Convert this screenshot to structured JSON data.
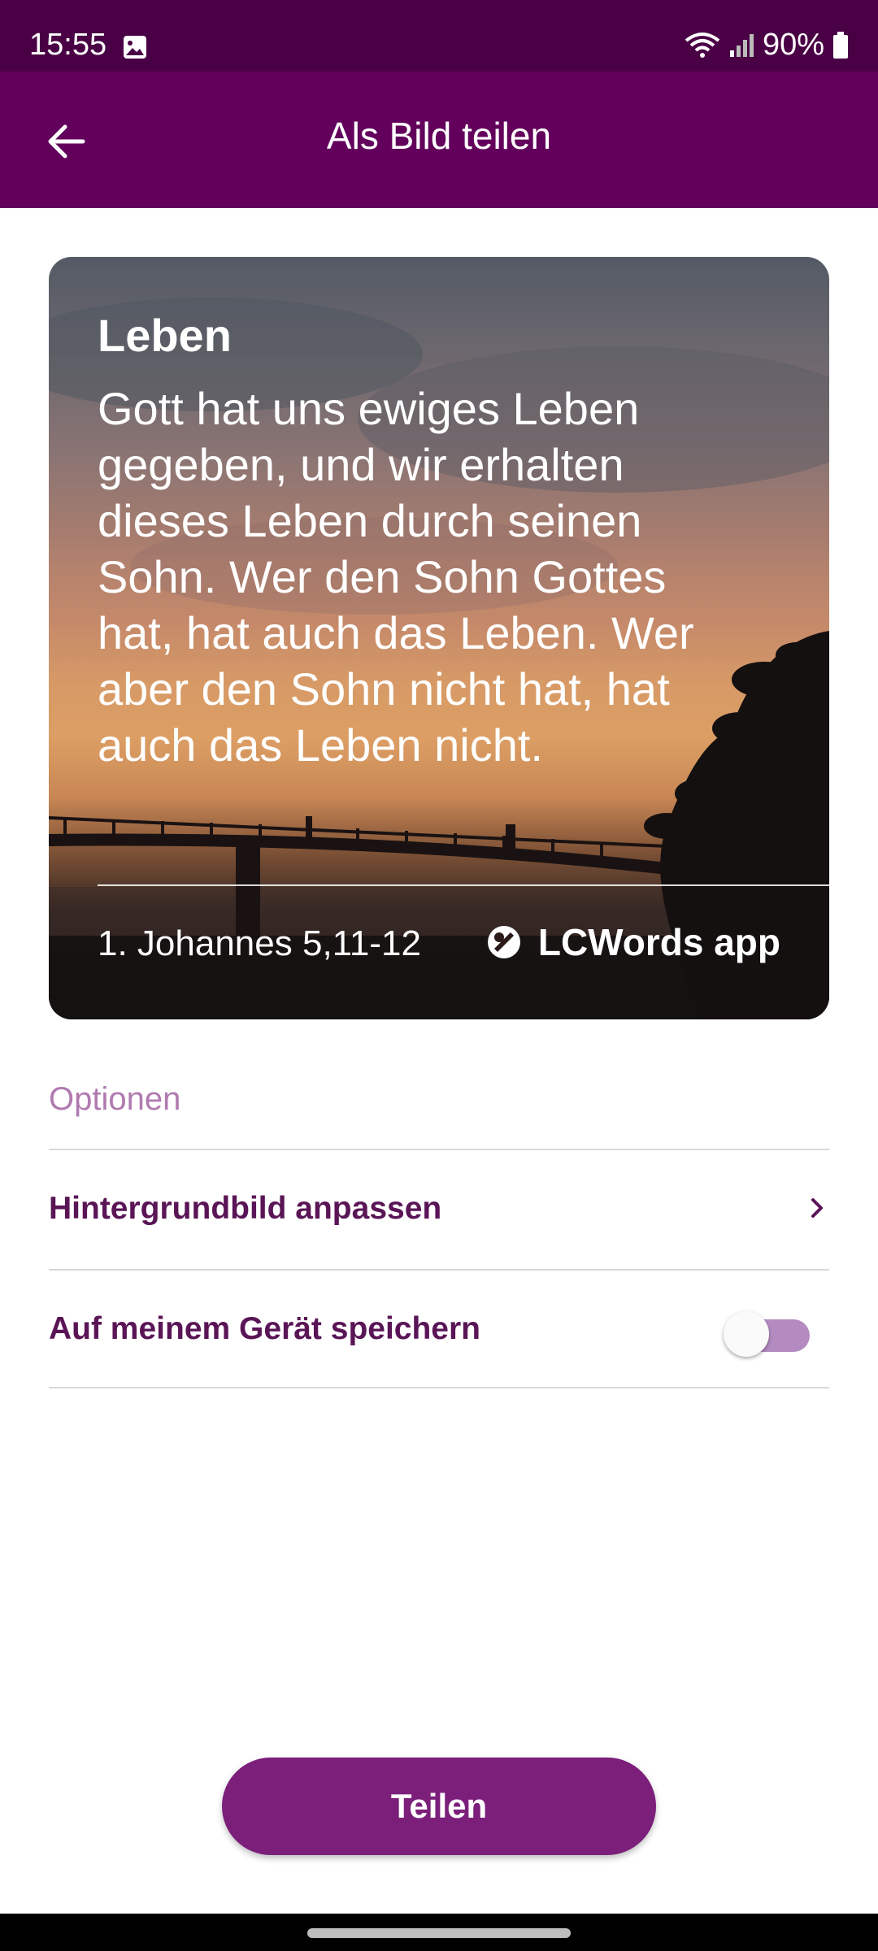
{
  "status_bar": {
    "time": "15:55",
    "battery": "90%",
    "icons": [
      "photo-icon",
      "wifi-icon",
      "signal-icon",
      "battery-icon"
    ]
  },
  "app_bar": {
    "title": "Als Bild teilen",
    "back_icon": "arrow-left-icon"
  },
  "card": {
    "title": "Leben",
    "verse": "Gott hat uns ewiges Leben gegeben, und wir erhalten dieses Leben durch seinen Sohn. Wer den Sohn Gottes hat, hat auch das Leben. Wer aber den Sohn nicht hat, hat auch das Leben nicht.",
    "reference": "1. Johannes 5,11-12",
    "brand": "LCWords app",
    "brand_icon": "lcwords-logo-icon"
  },
  "options": {
    "heading": "Optionen",
    "items": [
      {
        "label": "Hintergrundbild anpassen",
        "icon": "chevron-right-icon"
      },
      {
        "label": "Auf meinem Gerät speichern",
        "toggle_on": false
      }
    ]
  },
  "share_button": {
    "label": "Teilen"
  },
  "colors": {
    "status_bar": "#4a0045",
    "app_bar": "#62005b",
    "accent": "#7b1f7b",
    "option_text": "#5a1556",
    "options_heading": "#b07ab0"
  }
}
